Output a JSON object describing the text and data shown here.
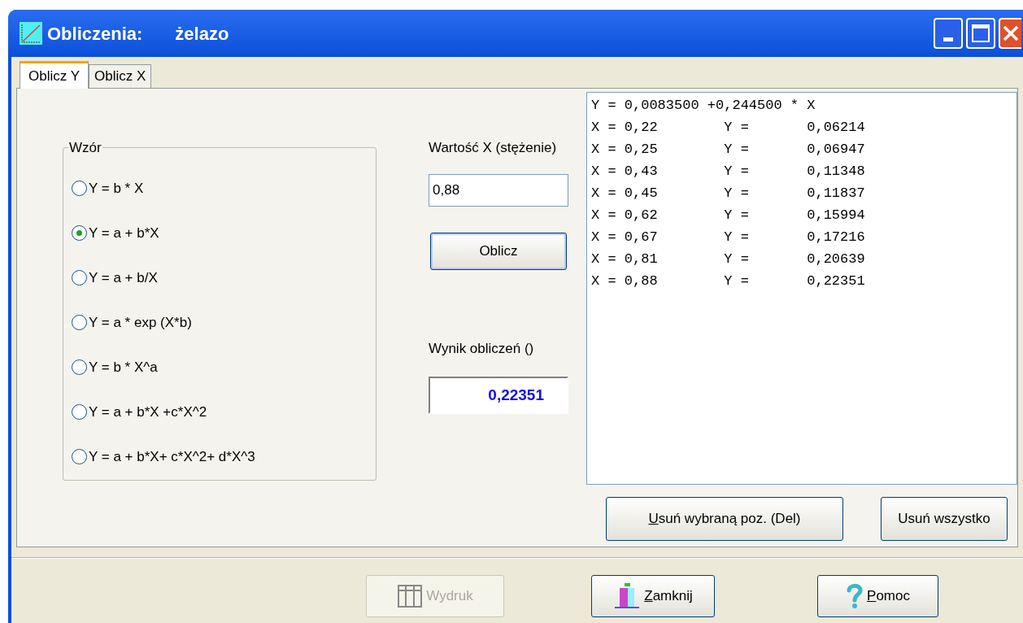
{
  "window": {
    "title": "Obliczenia:",
    "subtitle": "żelazo"
  },
  "tabs": [
    {
      "label": "Oblicz Y",
      "selected": true
    },
    {
      "label": "Oblicz X",
      "selected": false
    }
  ],
  "formula_group": {
    "title": "Wzór",
    "options": [
      {
        "label": "Y = b * X",
        "selected": false
      },
      {
        "label": "Y = a + b*X",
        "selected": true
      },
      {
        "label": "Y = a + b/X",
        "selected": false
      },
      {
        "label": "Y = a * exp (X*b)",
        "selected": false
      },
      {
        "label": "Y = b * X^a",
        "selected": false
      },
      {
        "label": "Y = a + b*X +c*X^2",
        "selected": false
      },
      {
        "label": "Y = a + b*X+ c*X^2+ d*X^3",
        "selected": false
      }
    ]
  },
  "x_value": {
    "label": "Wartość X (stężenie)",
    "value": "0,88"
  },
  "calculate_button": {
    "label": "Oblicz"
  },
  "result": {
    "label": "Wynik obliczeń ()",
    "value": "0,22351"
  },
  "results_list": [
    "Y = 0,0083500 +0,244500 * X",
    "X = 0,22        Y =       0,06214",
    "X = 0,25        Y =       0,06947",
    "X = 0,43        Y =       0,11348",
    "X = 0,45        Y =       0,11837",
    "X = 0,62        Y =       0,15994",
    "X = 0,67        Y =       0,17216",
    "X = 0,81        Y =       0,20639",
    "X = 0,88        Y =       0,22351"
  ],
  "list_buttons": [
    {
      "label": "Usuń wybraną poz. (Del)",
      "underline_first": true
    },
    {
      "label": "Usuń wszystko",
      "underline_first": false
    }
  ],
  "footer_buttons": [
    {
      "kind": "print",
      "label": "Wydruk",
      "disabled": true,
      "underline_first": false
    },
    {
      "kind": "close",
      "label": "Zamknij",
      "disabled": false,
      "underline_first": true
    },
    {
      "kind": "help",
      "label": "Pomoc",
      "disabled": false,
      "underline_first": true
    }
  ]
}
